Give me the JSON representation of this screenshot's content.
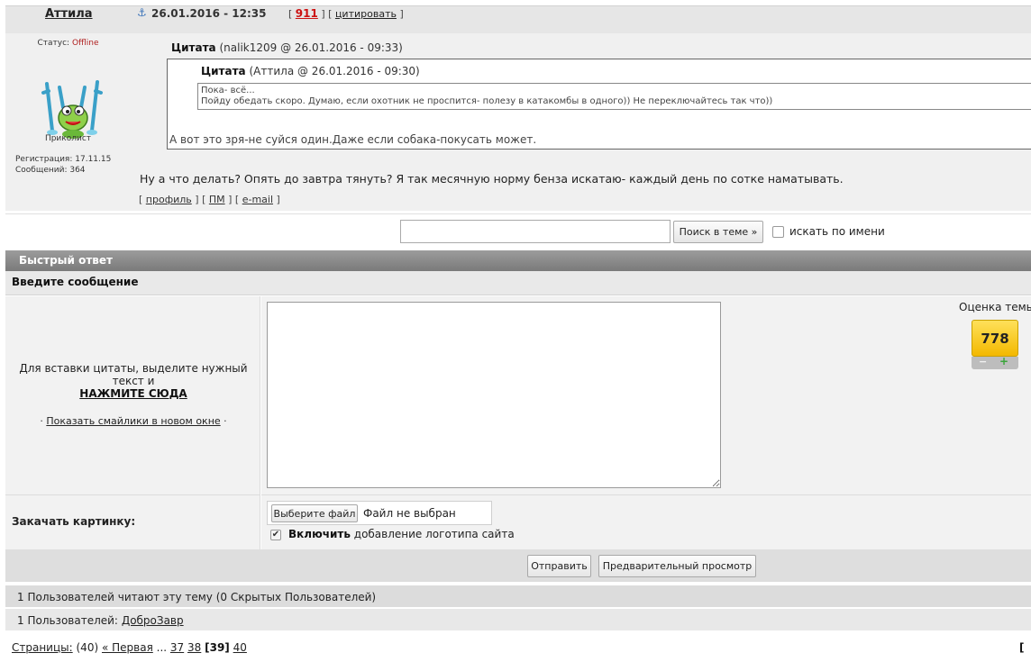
{
  "post": {
    "author": "Аттила",
    "date": "26.01.2016 - 12:35",
    "number": "911",
    "quote_action": "цитировать",
    "status_label": "Статус:",
    "status_value": "Offline",
    "user_group": "Приколист",
    "registration_label": "Регистрация:",
    "registration_date": "17.11.15",
    "messages_label": "Сообщений:",
    "messages_count": "364",
    "quote1": {
      "label": "Цитата",
      "meta": "(nalik1209 @ 26.01.2016 - 09:33)",
      "text": "А вот это зря-не суйся один.Даже если собака-покусать может."
    },
    "quote2": {
      "label": "Цитата",
      "meta": "(Аттила @ 26.01.2016 - 09:30)",
      "line1": "Пока- всё...",
      "line2": "Пойду обедать скоро. Думаю,  если охотник не проспится- полезу в катакомбы в одного)) Не переключайтесь так что))"
    },
    "text": "Ну а что делать? Опять до завтра тянуть? Я так месячную норму бенза искатаю- каждый день по сотке наматывать.",
    "links": {
      "profile": "профиль",
      "pm": "ПМ",
      "email": "e-mail"
    }
  },
  "search": {
    "button": "Поиск в теме »",
    "checkbox_label": "искать по имени",
    "value": ""
  },
  "quick_reply": {
    "header": "Быстрый ответ",
    "subheader": "Введите сообщение",
    "hint": "Для вставки цитаты, выделите нужный текст и",
    "click_here": "НАЖМИТЕ СЮДА",
    "smiles": "Показать смайлики в новом окне",
    "rating_label": "Оценка темы",
    "rating_value": "778",
    "upload_label": "Закачать картинку:",
    "file_button": "Выберите файл",
    "file_status": "Файл не выбран",
    "logo_bold": "Включить",
    "logo_rest": "добавление логотипа сайта",
    "send": "Отправить",
    "preview": "Предварительный просмотр",
    "message_value": ""
  },
  "footer": {
    "readers": "1 Пользователей читают эту тему (0 Скрытых Пользователей)",
    "users_prefix": "1 Пользователей:",
    "users_name": "ДоброЗавр",
    "pages_label": "Страницы:",
    "pages_total": "(40)",
    "first": "« Первая",
    "ellipsis": "...",
    "page_37": "37",
    "page_38": "38",
    "page_current": "[39]",
    "page_40": "40",
    "right_bracket": "["
  },
  "colors": {
    "accent_red": "#cc1111",
    "rating_yellow": "#f3b800",
    "header_gray": "#8a8a8a"
  },
  "icons": {
    "anchor": "anchor-icon",
    "check": "check-icon",
    "avatar": "frog-avatar"
  }
}
